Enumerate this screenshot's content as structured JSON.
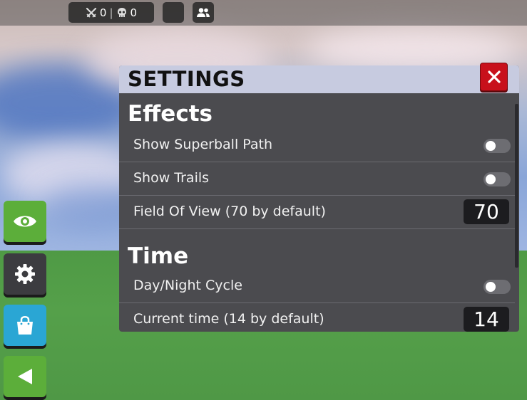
{
  "hud": {
    "stats": {
      "kills": "0",
      "separator": "|",
      "deaths": "0",
      "kills_icon": "crossed-swords-icon",
      "deaths_icon": "skull-icon"
    },
    "people_icon": "people-icon"
  },
  "side_buttons": [
    {
      "name": "eye-button",
      "icon": "eye-icon",
      "color": "#5cae3a"
    },
    {
      "name": "settings-button",
      "icon": "gear-icon",
      "color": "#3c3c40"
    },
    {
      "name": "shop-button",
      "icon": "shopping-bag-icon",
      "color": "#2aa6d4"
    },
    {
      "name": "back-button",
      "icon": "triangle-left-icon",
      "color": "#5cae3a"
    }
  ],
  "settings": {
    "title": "SETTINGS",
    "close_icon": "close-icon",
    "sections": [
      {
        "title": "Effects",
        "rows": [
          {
            "label": "Show Superball Path",
            "type": "toggle",
            "value": false
          },
          {
            "label": "Show Trails",
            "type": "toggle",
            "value": false
          },
          {
            "label": "Field Of View (70 by default)",
            "type": "number",
            "value": "70"
          }
        ]
      },
      {
        "title": "Time",
        "rows": [
          {
            "label": "Day/Night Cycle",
            "type": "toggle",
            "value": false
          },
          {
            "label": "Current time (14 by default)",
            "type": "number",
            "value": "14"
          }
        ]
      }
    ]
  },
  "colors": {
    "panel": "#4b4b4f",
    "header": "#c7cbe0",
    "close": "#c8101b",
    "green": "#5cae3a",
    "blue": "#2aa6d4"
  }
}
